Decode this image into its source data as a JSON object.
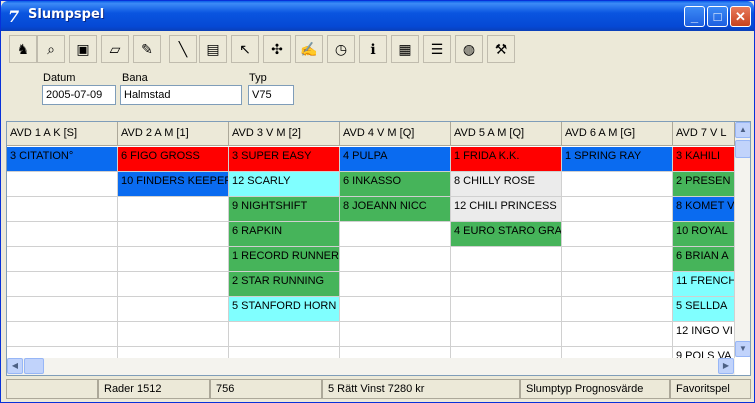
{
  "window": {
    "title": "Slumpspel"
  },
  "toolbar": {
    "icons": [
      "robot-icon",
      "binoculars-icon",
      "save-icon",
      "open-folder-icon",
      "pen-icon",
      "wand-icon",
      "window-icon",
      "arrow-icon",
      "puzzle-icon",
      "edit-icon",
      "clock-icon",
      "info-icon",
      "grid-icon",
      "list-icon",
      "database-icon",
      "tools-icon"
    ]
  },
  "fields": {
    "datum": {
      "label": "Datum",
      "value": "2005-07-09"
    },
    "bana": {
      "label": "Bana",
      "value": "Halmstad"
    },
    "typ": {
      "label": "Typ",
      "value": "V75"
    }
  },
  "colors": {
    "red": "#ff0000",
    "blue": "#0a6bf0",
    "green": "#46b45a",
    "cyan": "#80ffff",
    "grey": "#ebebeb",
    "white": "#ffffff"
  },
  "columns": [
    {
      "header": "AVD 1 A K [S]",
      "cells": [
        {
          "text": "3  CITATION°",
          "color": "blue"
        }
      ]
    },
    {
      "header": "AVD 2 A M [1]",
      "cells": [
        {
          "text": "6  FIGO GROSS",
          "color": "red"
        },
        {
          "text": "10  FINDERS KEEPER",
          "color": "blue"
        }
      ]
    },
    {
      "header": "AVD 3 V M [2]",
      "cells": [
        {
          "text": "3  SUPER EASY",
          "color": "red"
        },
        {
          "text": "12  SCARLY",
          "color": "cyan"
        },
        {
          "text": "9  NIGHTSHIFT",
          "color": "green"
        },
        {
          "text": "6  RAPKIN",
          "color": "green"
        },
        {
          "text": "1  RECORD RUNNER",
          "color": "green"
        },
        {
          "text": "2  STAR RUNNING",
          "color": "green"
        },
        {
          "text": "5  STANFORD HORN",
          "color": "cyan"
        }
      ]
    },
    {
      "header": "AVD 4 V M [Q]",
      "cells": [
        {
          "text": "4  PULPA",
          "color": "blue"
        },
        {
          "text": "6  INKASSO",
          "color": "green"
        },
        {
          "text": "8  JOEANN NICC",
          "color": "green"
        }
      ]
    },
    {
      "header": "AVD 5 A M [Q]",
      "cells": [
        {
          "text": "1  FRIDA K.K.",
          "color": "red"
        },
        {
          "text": "8  CHILLY ROSE",
          "color": "grey"
        },
        {
          "text": "12  CHILI PRINCESS",
          "color": "grey"
        },
        {
          "text": "4  EURO STARO GRA",
          "color": "green"
        }
      ]
    },
    {
      "header": "AVD 6 A M [G]",
      "cells": [
        {
          "text": "1  SPRING RAY",
          "color": "blue"
        }
      ]
    },
    {
      "header": "AVD 7 V L",
      "cells": [
        {
          "text": "3  KAHILI",
          "color": "red"
        },
        {
          "text": "2  PRESEN",
          "color": "green"
        },
        {
          "text": "8  KOMET V",
          "color": "blue"
        },
        {
          "text": "10  ROYAL",
          "color": "green"
        },
        {
          "text": "6  BRIAN A",
          "color": "green"
        },
        {
          "text": "11  FRENCH",
          "color": "cyan"
        },
        {
          "text": "5  SELLDA",
          "color": "cyan"
        },
        {
          "text": "12  INGO VI",
          "color": "white"
        },
        {
          "text": "9  POLS VA",
          "color": "white"
        }
      ]
    }
  ],
  "status": {
    "rows": "Rader 1512",
    "count": "756",
    "win": "5 Rätt   Vinst 7280 kr",
    "type": "Slumptyp Prognosvärde",
    "mode": "Favoritspel"
  }
}
